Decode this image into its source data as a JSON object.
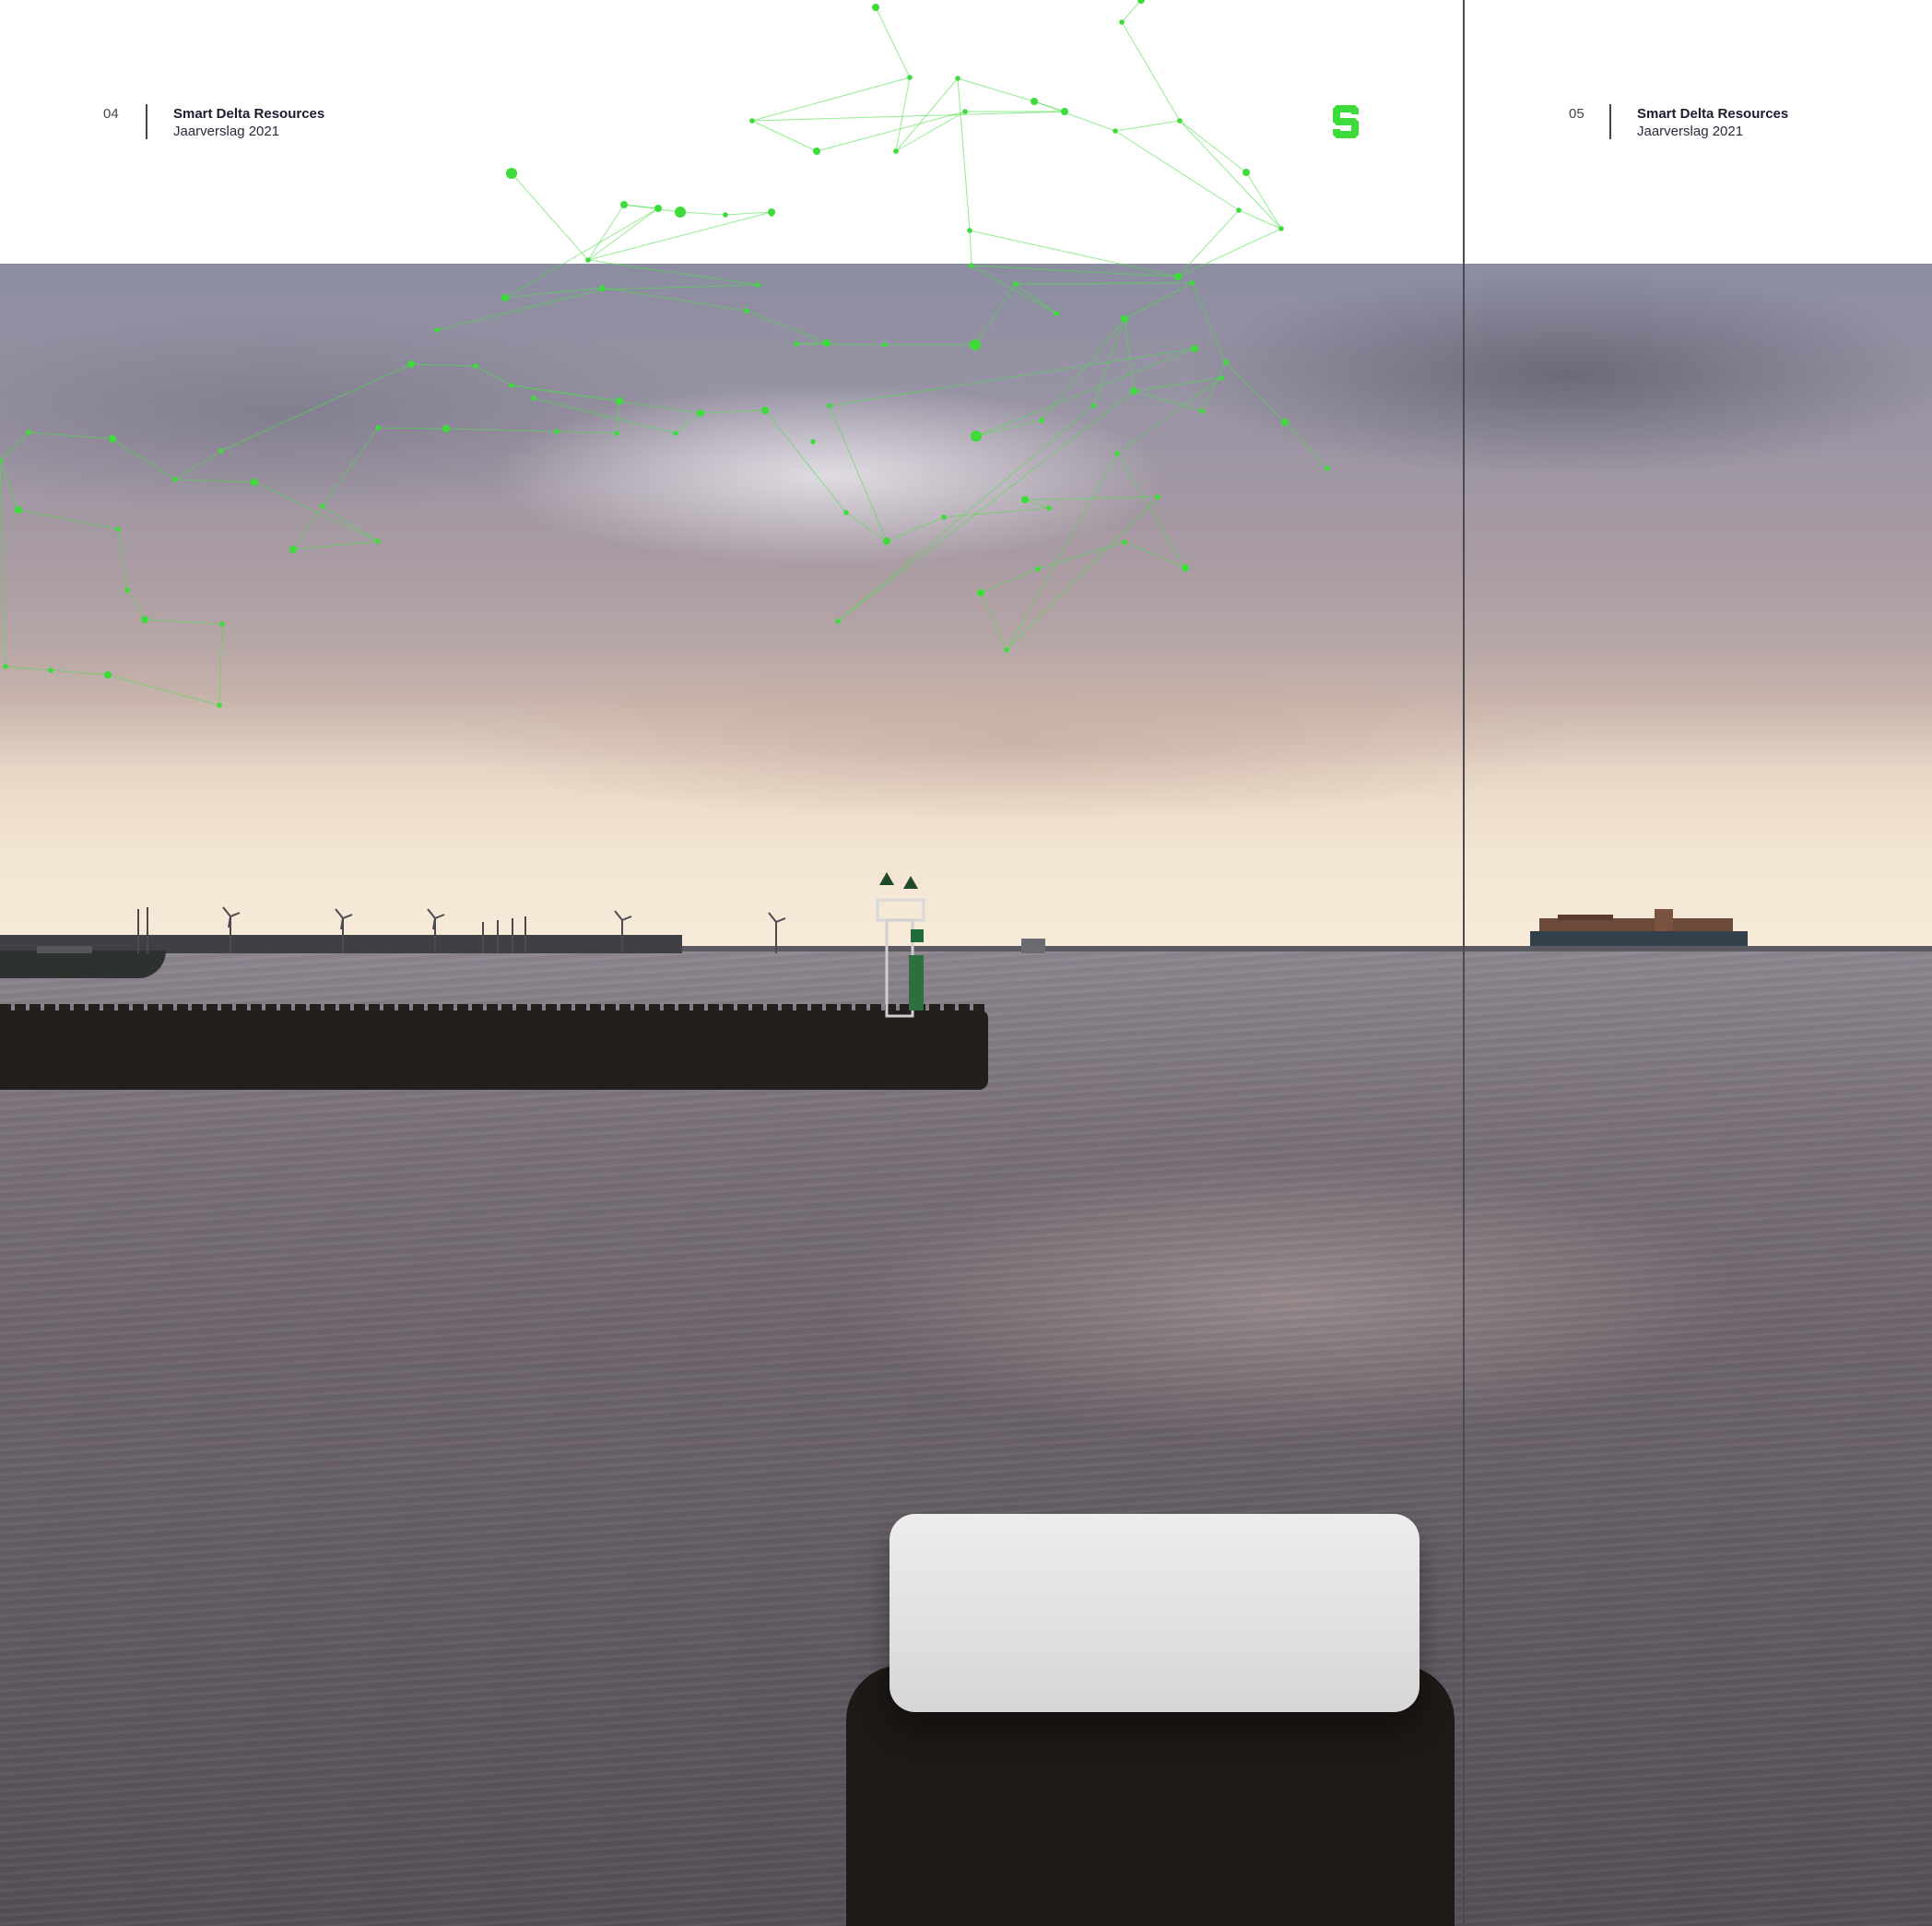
{
  "left_page": {
    "page_number": "04",
    "title": "Smart Delta Resources",
    "subtitle": "Jaarverslag 2021"
  },
  "right_page": {
    "page_number": "05",
    "title": "Smart Delta Resources",
    "subtitle": "Jaarverslag 2021"
  },
  "brand": {
    "logo_icon": "sdr-s-logo-icon",
    "accent_color": "#3ddc3a"
  },
  "photo": {
    "description_icons": [
      "harbor-jetty",
      "navigation-beacon",
      "container-ship",
      "mooring-bollard",
      "wind-turbines"
    ]
  }
}
